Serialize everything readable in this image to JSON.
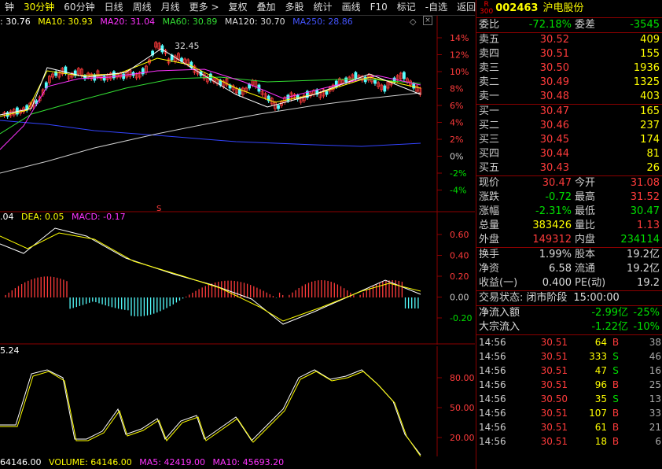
{
  "toolbar": {
    "items": [
      "钟",
      "30分钟",
      "60分钟",
      "日线",
      "周线",
      "月线",
      "更多 >",
      "复权",
      "叠加",
      "多股",
      "统计",
      "画线",
      "F10",
      "标记",
      "-自选",
      "返回"
    ],
    "active": "30分钟"
  },
  "ma": {
    "ma5": ": 30.76",
    "ma10": "MA10: 30.93",
    "ma20": "MA20: 31.04",
    "ma60": "MA60: 30.89",
    "ma120": "MA120: 30.70",
    "ma250": "MA250: 28.86"
  },
  "price_axis": {
    "pct": [
      "14%",
      "12%",
      "10%",
      "8%",
      "6%",
      "4%",
      "2%",
      "0%",
      "-2%",
      "-4%"
    ],
    "annot": "32.45",
    "marker": "S"
  },
  "macd": {
    "dif": ".04",
    "dea": "DEA: 0.05",
    "macd": "MACD: -0.17",
    "axis": [
      "0.60",
      "0.40",
      "0.20",
      "0.00",
      "-0.20"
    ]
  },
  "kdj": {
    "label": "5.24",
    "axis": [
      "80.00",
      "50.00",
      "20.00"
    ]
  },
  "volume": {
    "vol": "64146.00",
    "volume": "VOLUME: 64146.00",
    "ma5": "MA5: 42419.00",
    "ma10": "MA10: 45693.20"
  },
  "quote": {
    "badge": "R\n300",
    "code": "002463",
    "name": "沪电股份",
    "weibi_l": "委比",
    "weibi": "-72.18%",
    "weicha_l": "委差",
    "weicha": "-3545",
    "asks": [
      {
        "l": "卖五",
        "p": "30.52",
        "v": "409"
      },
      {
        "l": "卖四",
        "p": "30.51",
        "v": "155"
      },
      {
        "l": "卖三",
        "p": "30.50",
        "v": "1936"
      },
      {
        "l": "卖二",
        "p": "30.49",
        "v": "1325"
      },
      {
        "l": "卖一",
        "p": "30.48",
        "v": "403"
      }
    ],
    "bids": [
      {
        "l": "买一",
        "p": "30.47",
        "v": "165"
      },
      {
        "l": "买二",
        "p": "30.46",
        "v": "237"
      },
      {
        "l": "买三",
        "p": "30.45",
        "v": "174"
      },
      {
        "l": "买四",
        "p": "30.44",
        "v": "81"
      },
      {
        "l": "买五",
        "p": "30.43",
        "v": "26"
      }
    ],
    "stats": [
      {
        "a": "现价",
        "b": "30.47",
        "bc": "#ff3b3b",
        "c": "今开",
        "d": "31.08",
        "dc": "#ff3b3b"
      },
      {
        "a": "涨跌",
        "b": "-0.72",
        "bc": "#00e000",
        "c": "最高",
        "d": "31.52",
        "dc": "#ff3b3b"
      },
      {
        "a": "涨幅",
        "b": "-2.31%",
        "bc": "#00e000",
        "c": "最低",
        "d": "30.47",
        "dc": "#00e000"
      },
      {
        "a": "总量",
        "b": "383426",
        "bc": "#ffff00",
        "c": "量比",
        "d": "1.13",
        "dc": "#ff3b3b"
      },
      {
        "a": "外盘",
        "b": "149312",
        "bc": "#ff3b3b",
        "c": "内盘",
        "d": "234114",
        "dc": "#00e000"
      }
    ],
    "stats2": [
      {
        "a": "换手",
        "b": "1.99%",
        "bc": "#ddd",
        "c": "股本",
        "d": "19.2亿",
        "dc": "#ddd"
      },
      {
        "a": "净资",
        "b": "6.58",
        "bc": "#ddd",
        "c": "流通",
        "d": "19.2亿",
        "dc": "#ddd"
      },
      {
        "a": "收益(一)",
        "b": "0.400",
        "bc": "#ddd",
        "c": "PE(动)",
        "d": "19.2",
        "dc": "#ddd"
      }
    ],
    "status_l": "交易状态:",
    "status": "闭市阶段",
    "status_t": "15:00:00",
    "flow": [
      {
        "l": "净流入额",
        "v": "-2.99亿",
        "p": "-25%"
      },
      {
        "l": "大宗流入",
        "v": "-1.22亿",
        "p": "-10%"
      }
    ],
    "ticks": [
      {
        "t": "14:56",
        "p": "30.51",
        "v": "64",
        "f": "B",
        "n": "38"
      },
      {
        "t": "14:56",
        "p": "30.51",
        "v": "333",
        "f": "S",
        "n": "46"
      },
      {
        "t": "14:56",
        "p": "30.51",
        "v": "47",
        "f": "S",
        "n": "16"
      },
      {
        "t": "14:56",
        "p": "30.51",
        "v": "96",
        "f": "B",
        "n": "25"
      },
      {
        "t": "14:56",
        "p": "30.50",
        "v": "35",
        "f": "S",
        "n": "13"
      },
      {
        "t": "14:56",
        "p": "30.51",
        "v": "107",
        "f": "B",
        "n": "33"
      },
      {
        "t": "14:56",
        "p": "30.51",
        "v": "61",
        "f": "B",
        "n": "21"
      },
      {
        "t": "14:56",
        "p": "30.51",
        "v": "18",
        "f": "B",
        "n": "6"
      }
    ]
  },
  "colors": {
    "up": "#ff3b3b",
    "down": "#00e000",
    "yellow": "#ffff00",
    "cyan": "#5ff",
    "magenta": "#ff33ff",
    "green": "#33dd33",
    "blue": "#3344ff",
    "white": "#ffffff",
    "gray": "#cccccc"
  }
}
